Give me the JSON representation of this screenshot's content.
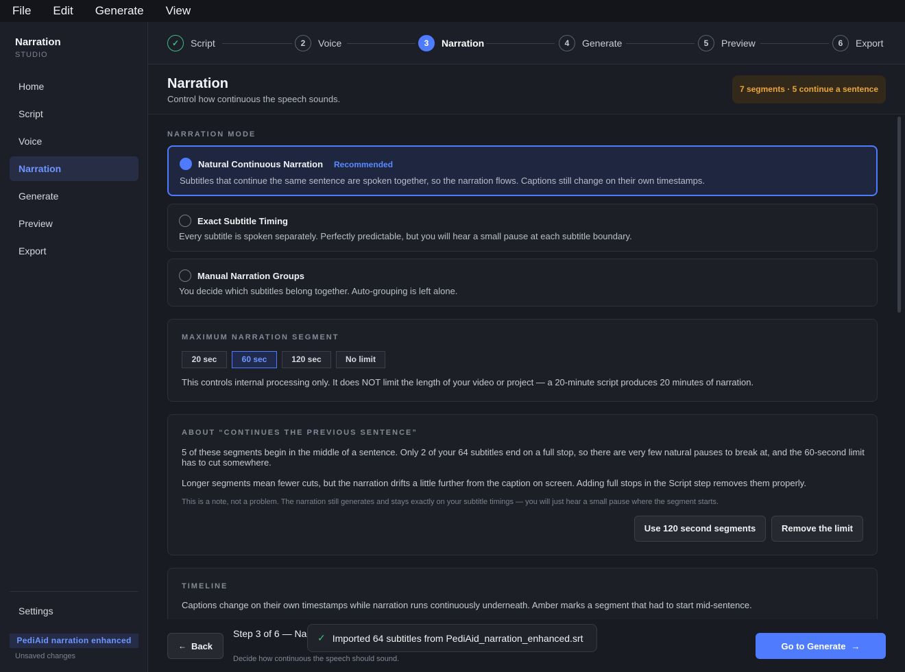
{
  "menu": [
    "File",
    "Edit",
    "Generate",
    "View"
  ],
  "sidebar": {
    "brand_name": "Narration",
    "brand_sub": "STUDIO",
    "items": [
      "Home",
      "Script",
      "Voice",
      "Narration",
      "Generate",
      "Preview",
      "Export"
    ],
    "active_item": "Narration",
    "settings": "Settings",
    "project_name": "PediAid narration enhanced",
    "unsaved": "Unsaved changes"
  },
  "stepper": {
    "steps": [
      {
        "num": "✓",
        "label": "Script",
        "state": "done"
      },
      {
        "num": "2",
        "label": "Voice",
        "state": "todo"
      },
      {
        "num": "3",
        "label": "Narration",
        "state": "current"
      },
      {
        "num": "4",
        "label": "Generate",
        "state": "todo"
      },
      {
        "num": "5",
        "label": "Preview",
        "state": "todo"
      },
      {
        "num": "6",
        "label": "Export",
        "state": "todo"
      }
    ]
  },
  "header": {
    "title": "Narration",
    "subtitle": "Control how continuous the speech sounds.",
    "badge": "7 segments · 5 continue a sentence"
  },
  "mode": {
    "section_label": "NARRATION MODE",
    "options": [
      {
        "title": "Natural Continuous Narration",
        "tag": "Recommended",
        "desc": "Subtitles that continue the same sentence are spoken together, so the narration flows. Captions still change on their own timestamps.",
        "selected": true
      },
      {
        "title": "Exact Subtitle Timing",
        "tag": "",
        "desc": "Every subtitle is spoken separately. Perfectly predictable, but you will hear a small pause at each subtitle boundary.",
        "selected": false
      },
      {
        "title": "Manual Narration Groups",
        "tag": "",
        "desc": "You decide which subtitles belong together. Auto-grouping is left alone.",
        "selected": false
      }
    ]
  },
  "max_segment": {
    "label": "MAXIMUM NARRATION SEGMENT",
    "options": [
      "20 sec",
      "60 sec",
      "120 sec",
      "No limit"
    ],
    "selected": "60 sec",
    "note": "This controls internal processing only. It does NOT limit the length of your video or project — a 20-minute script produces 20 minutes of narration."
  },
  "about": {
    "label": "ABOUT “CONTINUES THE PREVIOUS SENTENCE”",
    "para1": "5 of these segments begin in the middle of a sentence. Only 2 of your 64 subtitles end on a full stop, so there are very few natural pauses to break at, and the 60-second limit has to cut somewhere.",
    "para2": "Longer segments mean fewer cuts, but the narration drifts a little further from the caption on screen. Adding full stops in the Script step removes them properly.",
    "note": "This is a note, not a problem. The narration still generates and stays exactly on your subtitle timings — you will just hear a small pause where the segment starts.",
    "btn_120": "Use 120 second segments",
    "btn_remove": "Remove the limit"
  },
  "timeline": {
    "label": "TIMELINE",
    "text": "Captions change on their own timestamps while narration runs continuously underneath. Amber marks a segment that had to start mid-sentence."
  },
  "footer": {
    "back": "Back",
    "step_info": "Step 3 of 6 — Narration",
    "step_sub": "Decide how continuous the speech should sound.",
    "toast": "Imported 64 subtitles from PediAid_narration_enhanced.srt",
    "next": "Go to Generate"
  },
  "colors": {
    "accent": "#4f7bff",
    "success": "#3fbf7f",
    "warning": "#e9a53a",
    "background": "#181b22"
  }
}
